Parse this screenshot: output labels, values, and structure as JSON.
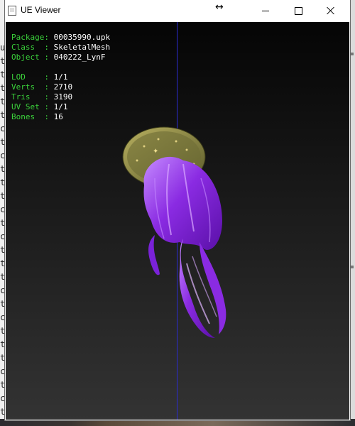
{
  "window": {
    "title": "UE Viewer",
    "buttons": {
      "minimize": "minimize-icon",
      "maximize": "maximize-icon",
      "close": "close-icon"
    }
  },
  "info": {
    "package": {
      "key": "Package:",
      "value": "00035990.upk"
    },
    "class": {
      "key": "Class  :",
      "value": "SkeletalMesh"
    },
    "object": {
      "key": "Object :",
      "value": "040222_LynF"
    },
    "lod": {
      "key": "LOD    :",
      "value": "1/1"
    },
    "verts": {
      "key": "Verts  :",
      "value": "2710"
    },
    "tris": {
      "key": "Tris   :",
      "value": "3190"
    },
    "uvset": {
      "key": "UV Set :",
      "value": "1/1"
    },
    "bones": {
      "key": "Bones  :",
      "value": "16"
    }
  },
  "background_terminal": {
    "chars": [
      "u",
      "t",
      "t",
      "t",
      "t",
      "t",
      "c",
      "t",
      "c",
      "t",
      "t",
      "t",
      "c",
      "t",
      "c",
      "t",
      "t",
      "t",
      "c",
      "t",
      "c",
      "t",
      "t",
      "t",
      "c",
      "t",
      "c",
      "t",
      "t",
      "t"
    ]
  },
  "colors": {
    "info_key": "#3bd23b",
    "info_value": "#ffffff",
    "axis": "#2b2bd0",
    "hair": "#9b3cf0",
    "hat": "#8c8a4a"
  }
}
